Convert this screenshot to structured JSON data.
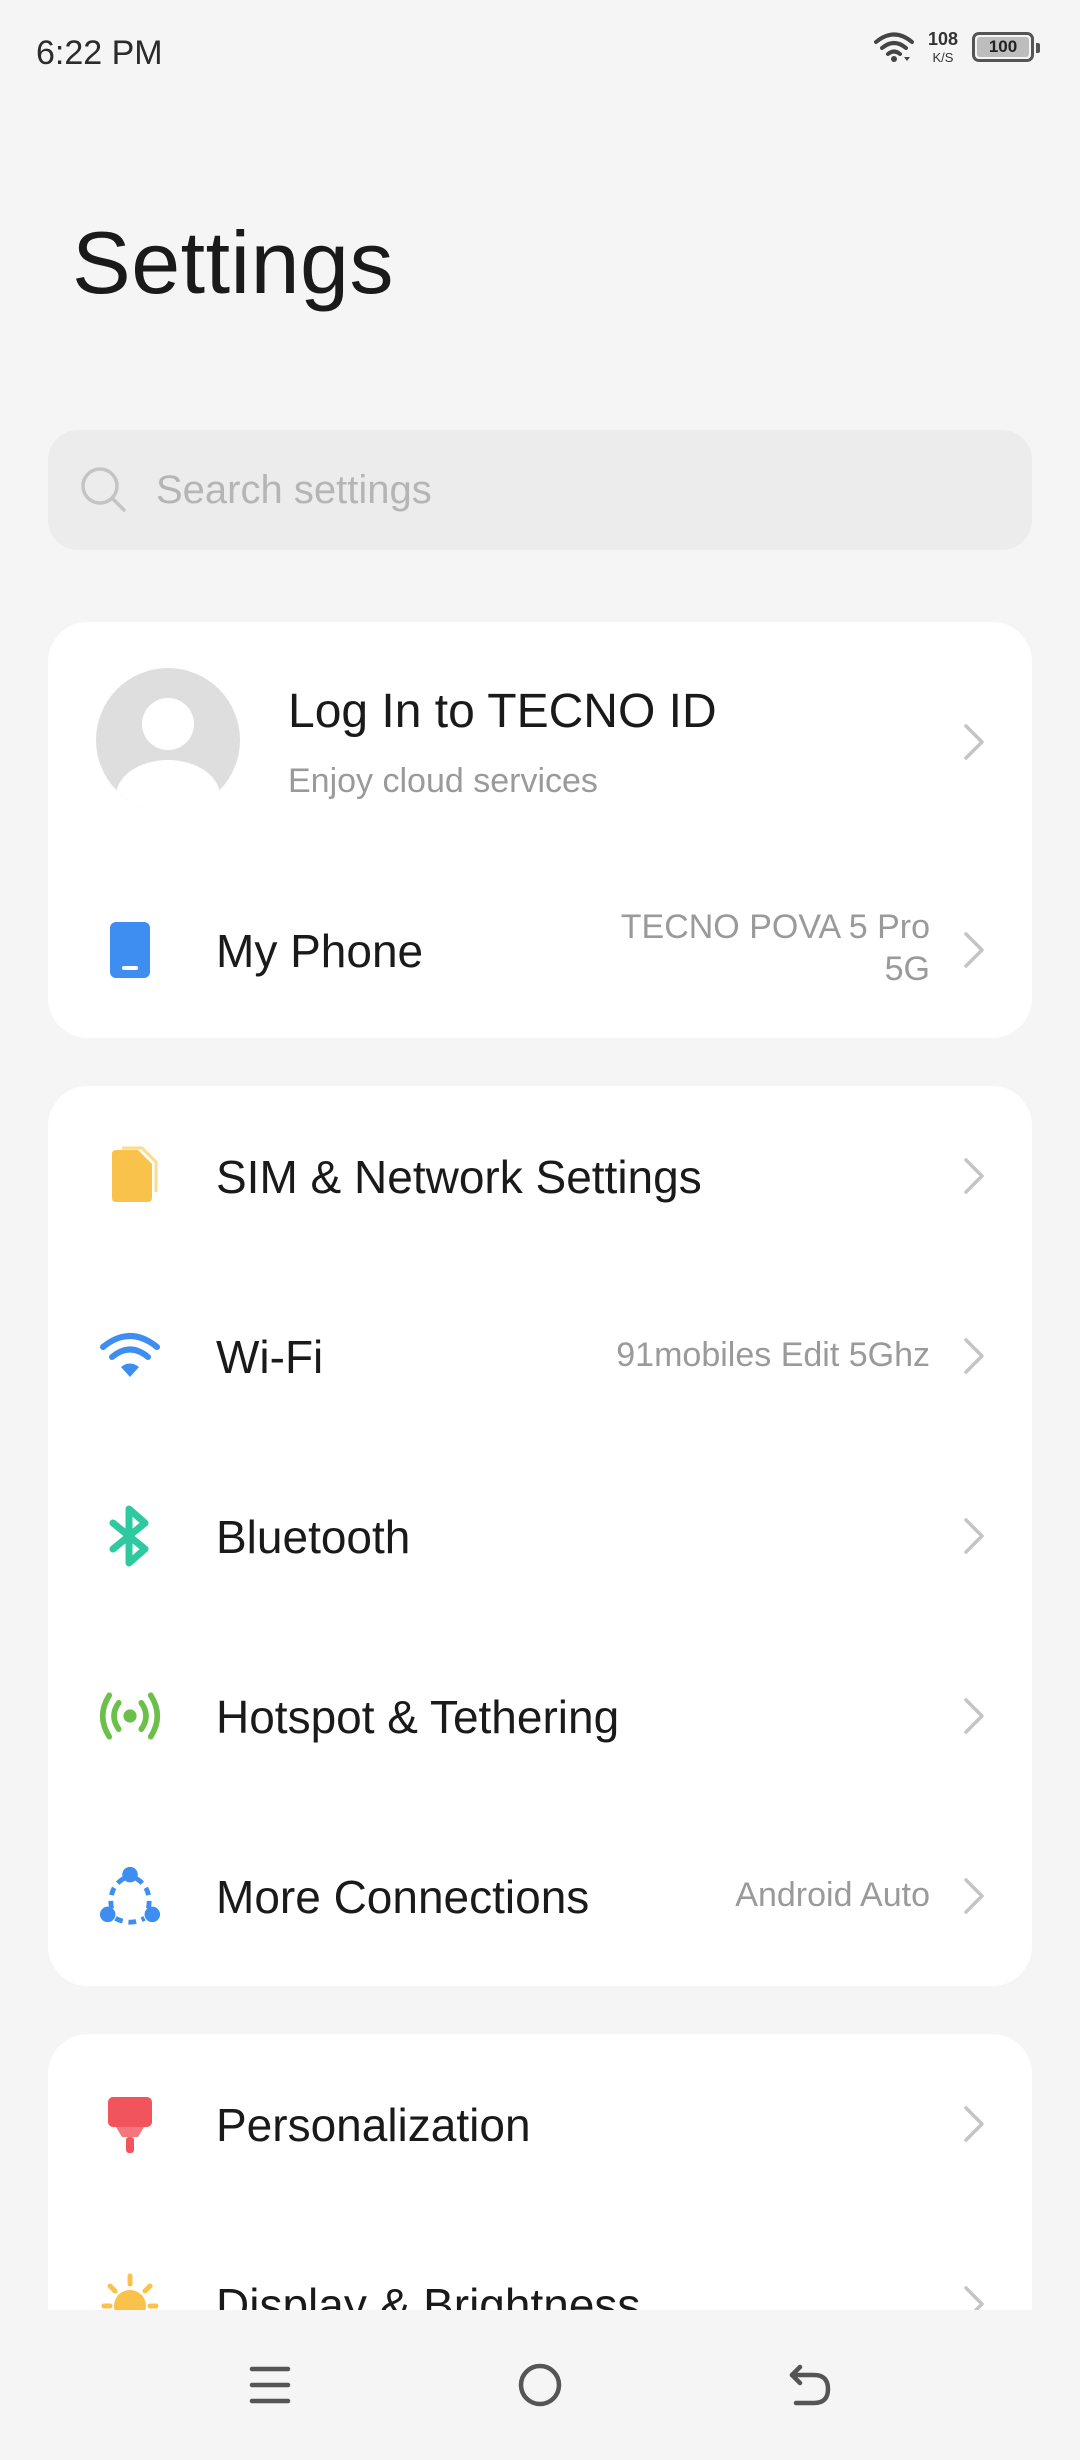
{
  "status": {
    "time": "6:22 PM",
    "net_speed_value": "108",
    "net_speed_unit": "K/S",
    "battery": "100"
  },
  "title": "Settings",
  "search": {
    "placeholder": "Search settings"
  },
  "account": {
    "title": "Log In to TECNO ID",
    "subtitle": "Enjoy cloud services"
  },
  "my_phone": {
    "label": "My Phone",
    "value_line1": "TECNO POVA 5 Pro",
    "value_line2": "5G"
  },
  "connections": [
    {
      "label": "SIM & Network Settings",
      "value": "",
      "icon": "sim-card-icon",
      "color": "#f9c24a"
    },
    {
      "label": "Wi-Fi",
      "value": "91mobiles Edit 5Ghz",
      "icon": "wifi-icon",
      "color": "#3d8ef0"
    },
    {
      "label": "Bluetooth",
      "value": "",
      "icon": "bluetooth-icon",
      "color": "#2fc9a0"
    },
    {
      "label": "Hotspot & Tethering",
      "value": "",
      "icon": "hotspot-icon",
      "color": "#6cc04a"
    },
    {
      "label": "More Connections",
      "value": "Android Auto",
      "icon": "more-connections-icon",
      "color": "#3d8ef0"
    }
  ],
  "personal": [
    {
      "label": "Personalization",
      "icon": "paint-brush-icon",
      "color": "#f2545b"
    },
    {
      "label": "Display & Brightness",
      "icon": "sun-icon",
      "color": "#f9c24a"
    }
  ],
  "nav": {
    "menu": "menu-icon",
    "home": "home-icon",
    "back": "back-icon"
  }
}
